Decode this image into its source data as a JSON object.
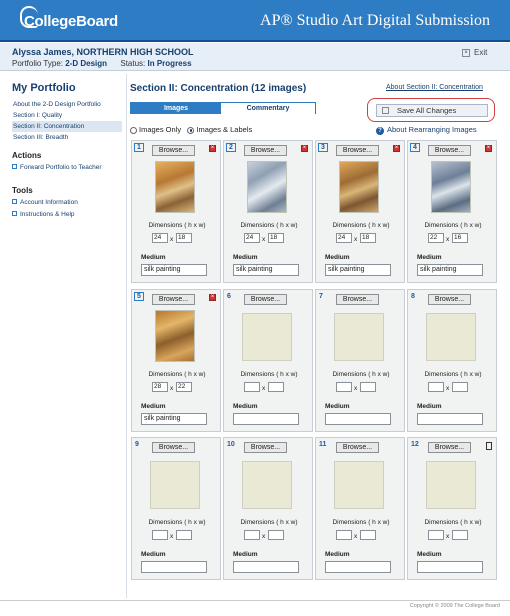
{
  "header": {
    "logo_text": "CollegeBoard",
    "app_title": "AP® Studio Art Digital Submission",
    "brand_color": "#2d7cc4"
  },
  "userbar": {
    "name": "Alyssa James, NORTHERN HIGH SCHOOL",
    "portfolio_type_label": "Portfolio Type:",
    "portfolio_type": "2-D Design",
    "status_label": "Status:",
    "status": "In Progress",
    "exit_label": "Exit"
  },
  "sidebar": {
    "title": "My Portfolio",
    "items": [
      {
        "label": "About the 2-D Design Portfolio"
      },
      {
        "label": "Section I: Quality"
      },
      {
        "label": "Section II: Concentration"
      },
      {
        "label": "Section III: Breadth"
      }
    ],
    "actions_title": "Actions",
    "actions": [
      {
        "label": "Forward Portfolio to Teacher"
      }
    ],
    "tools_title": "Tools",
    "tools": [
      {
        "label": "Account Information"
      },
      {
        "label": "Instructions & Help"
      }
    ]
  },
  "main": {
    "section_title": "Section II: Concentration (12 images)",
    "about_link": "About Section II: Concentration",
    "tabs": [
      {
        "label": "Images"
      },
      {
        "label": "Commentary"
      }
    ],
    "save_button": "Save All Changes",
    "radio_images_only": "Images Only",
    "radio_images_labels": "Images & Labels",
    "rearranging_link": "About Rearranging Images",
    "browse_label": "Browse...",
    "dimensions_label": "Dimensions ( h x w)",
    "x_label": "x",
    "medium_label": "Medium"
  },
  "cells": [
    {
      "num": "1",
      "h": "24",
      "w": "18",
      "medium": "silk painting"
    },
    {
      "num": "2",
      "h": "24",
      "w": "18",
      "medium": "silk painting"
    },
    {
      "num": "3",
      "h": "24",
      "w": "18",
      "medium": "silk painting"
    },
    {
      "num": "4",
      "h": "22",
      "w": "16",
      "medium": "silk painting"
    },
    {
      "num": "5",
      "h": "28",
      "w": "22",
      "medium": "silk painting"
    },
    {
      "num": "6",
      "h": "",
      "w": "",
      "medium": ""
    },
    {
      "num": "7",
      "h": "",
      "w": "",
      "medium": ""
    },
    {
      "num": "8",
      "h": "",
      "w": "",
      "medium": ""
    },
    {
      "num": "9",
      "h": "",
      "w": "",
      "medium": ""
    },
    {
      "num": "10",
      "h": "",
      "w": "",
      "medium": ""
    },
    {
      "num": "11",
      "h": "",
      "w": "",
      "medium": ""
    },
    {
      "num": "12",
      "h": "",
      "w": "",
      "medium": ""
    }
  ],
  "footer": {
    "copyright": "Copyright © 2009 The College Board"
  }
}
